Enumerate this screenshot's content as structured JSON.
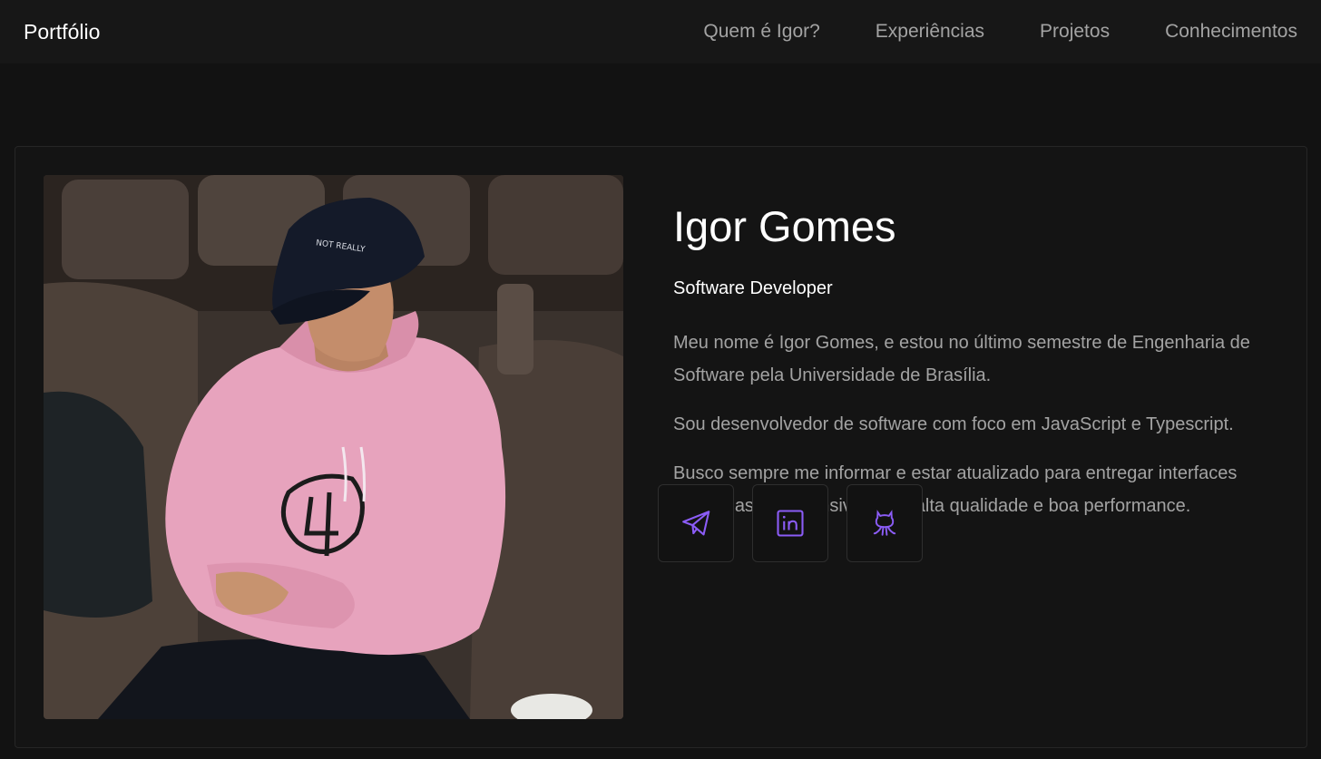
{
  "nav": {
    "brand": "Portfólio",
    "links": [
      {
        "label": "Quem é Igor?"
      },
      {
        "label": "Experiências"
      },
      {
        "label": "Projetos"
      },
      {
        "label": "Conhecimentos"
      }
    ]
  },
  "profile": {
    "name": "Igor Gomes",
    "role": "Software Developer",
    "bio": [
      "Meu nome é Igor Gomes, e estou no último semestre de Engenharia de Software pela Universidade de Brasília.",
      "Sou desenvolvedor de software com foco em JavaScript e Typescript.",
      "Busco sempre me informar e estar atualizado para entregar interfaces modernas e responsivas com alta qualidade e boa performance."
    ],
    "photo_cap_text": "NOT REALLY"
  },
  "socials": [
    {
      "icon": "telegram-icon"
    },
    {
      "icon": "linkedin-icon"
    },
    {
      "icon": "github-icon"
    }
  ],
  "colors": {
    "background": "#121212",
    "navbar": "#171717",
    "accent": "#8b5cf6",
    "muted_text": "#a3a3a3"
  }
}
